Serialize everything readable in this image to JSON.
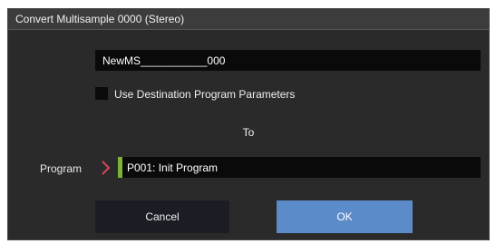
{
  "dialog": {
    "title": "Convert Multisample 0000 (Stereo)"
  },
  "name_field": {
    "value": "NewMS___________000"
  },
  "checkbox": {
    "label": "Use Destination Program Parameters",
    "checked": false
  },
  "to_label": "To",
  "program": {
    "label": "Program",
    "value": "P001: Init Program",
    "chevron_icon": "chevron-right-icon",
    "accent_color": "#7fb23a",
    "chevron_color": "#d9455a"
  },
  "buttons": {
    "cancel_label": "Cancel",
    "ok_label": "OK",
    "ok_color": "#5b8bc9"
  }
}
